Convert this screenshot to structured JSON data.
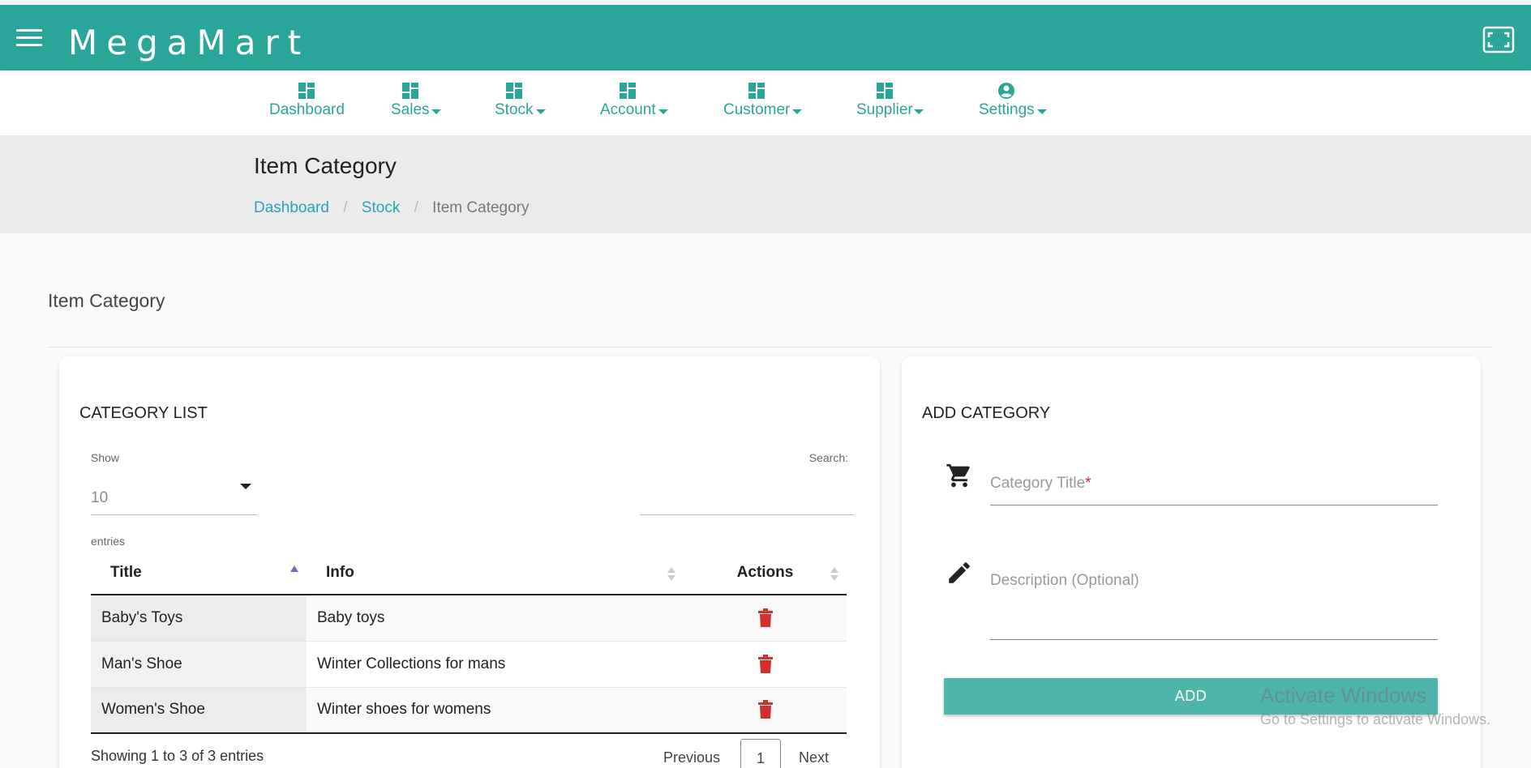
{
  "app": {
    "brand": "MegaMart",
    "theme_color": "#2aa59a"
  },
  "nav": {
    "items": [
      {
        "label": "Dashboard",
        "icon": "dashboard-icon",
        "has_menu": false
      },
      {
        "label": "Sales",
        "icon": "dashboard-icon",
        "has_menu": true
      },
      {
        "label": "Stock",
        "icon": "dashboard-icon",
        "has_menu": true
      },
      {
        "label": "Account",
        "icon": "dashboard-icon",
        "has_menu": true
      },
      {
        "label": "Customer",
        "icon": "dashboard-icon",
        "has_menu": true
      },
      {
        "label": "Supplier",
        "icon": "dashboard-icon",
        "has_menu": true
      },
      {
        "label": "Settings",
        "icon": "account-circle-icon",
        "has_menu": true
      }
    ]
  },
  "header": {
    "title": "Item Category",
    "breadcrumb": [
      "Dashboard",
      "Stock",
      "Item Category"
    ],
    "separator": "/"
  },
  "section": {
    "title": "Item Category"
  },
  "category_list": {
    "title": "CATEGORY LIST",
    "show_label": "Show",
    "page_length": "10",
    "entries_label": "entries",
    "search_label": "Search:",
    "search_value": "",
    "columns": [
      "Title",
      "Info",
      "Actions"
    ],
    "rows": [
      {
        "title": "Baby's Toys",
        "info": "Baby toys"
      },
      {
        "title": "Man's Shoe",
        "info": "Winter Collections for mans"
      },
      {
        "title": "Women's Shoe",
        "info": "Winter shoes for womens"
      }
    ],
    "delete_color": "#d32f2f",
    "info_text": "Showing 1 to 3 of 3 entries",
    "pagination": {
      "previous": "Previous",
      "current_page": "1",
      "next": "Next"
    }
  },
  "add_category": {
    "title": "ADD CATEGORY",
    "title_field_label": "Category Title",
    "title_field_required": "*",
    "title_field_value": "",
    "description_field_label": "Description (Optional)",
    "description_field_value": "",
    "button_label": "ADD"
  },
  "watermark": {
    "line1": "Activate Windows",
    "line2": "Go to Settings to activate Windows."
  }
}
